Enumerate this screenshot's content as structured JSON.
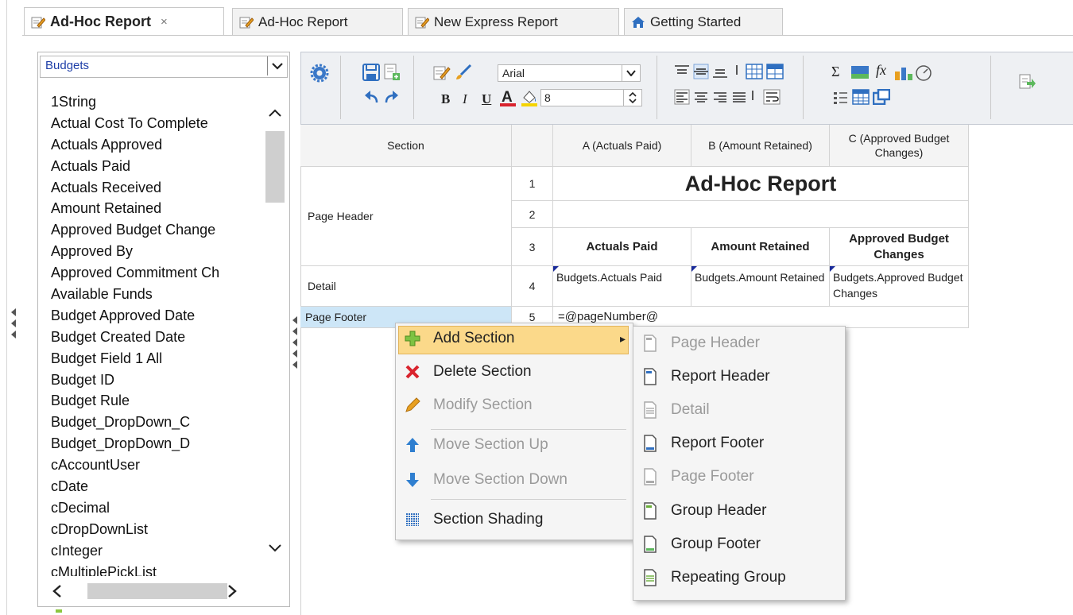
{
  "tabs": [
    {
      "label": "Ad-Hoc Report",
      "close": "×",
      "active": true
    },
    {
      "label": "Ad-Hoc Report",
      "active": false
    },
    {
      "label": "New Express Report",
      "active": false
    },
    {
      "label": "Getting Started",
      "active": false
    }
  ],
  "field_panel": {
    "selected_category": "Budgets",
    "fields": [
      "1String",
      "Actual Cost To Complete",
      "Actuals Approved",
      "Actuals Paid",
      "Actuals Received",
      "Amount Retained",
      "Approved Budget Change",
      "Approved By",
      "Approved Commitment Ch",
      "Available Funds",
      "Budget Approved Date",
      "Budget Created Date",
      "Budget Field 1 All",
      "Budget ID",
      "Budget Rule",
      "Budget_DropDown_C",
      "Budget_DropDown_D",
      "cAccountUser",
      "cDate",
      "cDecimal",
      "cDropDownList",
      "cInteger",
      "cMultiplePickList"
    ]
  },
  "toolbar": {
    "font_name": "Arial",
    "font_size": "8"
  },
  "grid": {
    "section_header": "Section",
    "columns": [
      "A (Actuals Paid)",
      "B (Amount Retained)",
      "C (Approved Budget Changes)"
    ],
    "sections": [
      "Page Header",
      "Detail",
      "Page Footer"
    ],
    "row_numbers": [
      "1",
      "2",
      "3",
      "4",
      "5"
    ],
    "title": "Ad-Hoc Report",
    "headers": [
      "Actuals Paid",
      "Amount Retained",
      "Approved Budget Changes"
    ],
    "detail": [
      "Budgets.Actuals Paid",
      "Budgets.Amount Retained",
      "Budgets.Approved Budget Changes"
    ],
    "footer": "=@pageNumber@"
  },
  "context_menu": {
    "items": [
      {
        "label": "Add Section",
        "icon": "plus-icon",
        "enabled": true,
        "highlighted": true,
        "submenu": "▸"
      },
      {
        "label": "Delete Section",
        "icon": "x-icon",
        "enabled": true
      },
      {
        "label": "Modify Section",
        "icon": "pencil-icon",
        "enabled": false
      },
      {
        "label": "Move Section Up",
        "icon": "arrow-up-icon",
        "enabled": false
      },
      {
        "label": "Move Section Down",
        "icon": "arrow-down-icon",
        "enabled": false
      },
      {
        "label": "Section Shading",
        "icon": "shading-icon",
        "enabled": true
      }
    ]
  },
  "submenu": {
    "items": [
      {
        "label": "Page Header",
        "enabled": false
      },
      {
        "label": "Report Header",
        "enabled": true
      },
      {
        "label": "Detail",
        "enabled": false
      },
      {
        "label": "Report Footer",
        "enabled": true
      },
      {
        "label": "Page Footer",
        "enabled": false
      },
      {
        "label": "Group Header",
        "enabled": true
      },
      {
        "label": "Group Footer",
        "enabled": true
      },
      {
        "label": "Repeating Group",
        "enabled": true
      }
    ]
  },
  "colors": {
    "accent_blue": "#1f3fa8",
    "menu_highlight": "#fbd98a",
    "selected_section": "#cde6f7",
    "toolbar_bg": "#eef0f3"
  }
}
